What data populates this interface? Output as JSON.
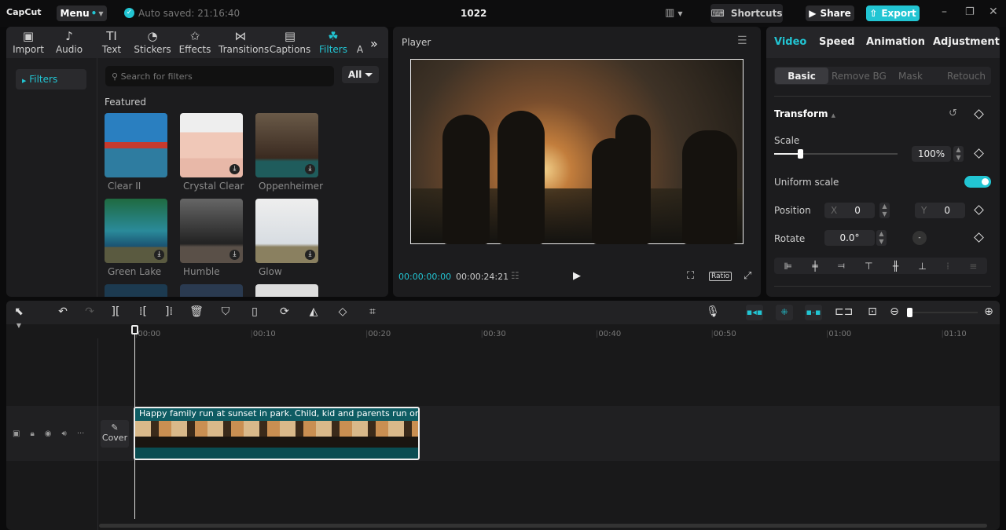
{
  "app": {
    "logo": "CapCut",
    "menu": "Menu",
    "autosave": "Auto saved: 21:16:40",
    "project_title": "1022",
    "shortcuts": "Shortcuts",
    "share": "Share",
    "export": "Export"
  },
  "media_tabs": [
    {
      "label": "Import",
      "icon": "import-icon"
    },
    {
      "label": "Audio",
      "icon": "audio-icon"
    },
    {
      "label": "Text",
      "icon": "text-icon"
    },
    {
      "label": "Stickers",
      "icon": "stickers-icon"
    },
    {
      "label": "Effects",
      "icon": "effects-icon"
    },
    {
      "label": "Transitions",
      "icon": "transitions-icon"
    },
    {
      "label": "Captions",
      "icon": "captions-icon"
    },
    {
      "label": "Filters",
      "icon": "filters-icon",
      "active": true
    },
    {
      "label": "A",
      "icon": "adjust-icon"
    }
  ],
  "filters": {
    "sidebar_item": "Filters",
    "search_placeholder": "Search for filters",
    "all_label": "All",
    "section": "Featured",
    "items": [
      {
        "name": "Clear II"
      },
      {
        "name": "Crystal Clear"
      },
      {
        "name": "Oppenheimer"
      },
      {
        "name": "Green Lake"
      },
      {
        "name": "Humble"
      },
      {
        "name": "Glow"
      }
    ]
  },
  "player": {
    "title": "Player",
    "current_time": "00:00:00:00",
    "total_time": "00:00:24:21",
    "ratio": "Ratio"
  },
  "inspector": {
    "tabs": [
      "Video",
      "Speed",
      "Animation",
      "Adjustment"
    ],
    "subtabs": [
      "Basic",
      "Remove BG",
      "Mask",
      "Retouch"
    ],
    "section": "Transform",
    "scale_label": "Scale",
    "scale_value": "100%",
    "scale_percent": 100,
    "uniform_scale": "Uniform scale",
    "uniform_on": true,
    "position_label": "Position",
    "x_label": "X",
    "x_value": "0",
    "y_label": "Y",
    "y_value": "0",
    "rotate_label": "Rotate",
    "rotate_value": "0.0°"
  },
  "timeline": {
    "ticks": [
      "00:00",
      "00:10",
      "00:20",
      "00:30",
      "00:40",
      "00:50",
      "01:00",
      "01:10"
    ],
    "clip_title": "Happy family run at sunset in park. Child, kid and parents run on green g",
    "cover": "Cover"
  },
  "colors": {
    "accent": "#22c5d3",
    "clip": "#0e5c63"
  }
}
